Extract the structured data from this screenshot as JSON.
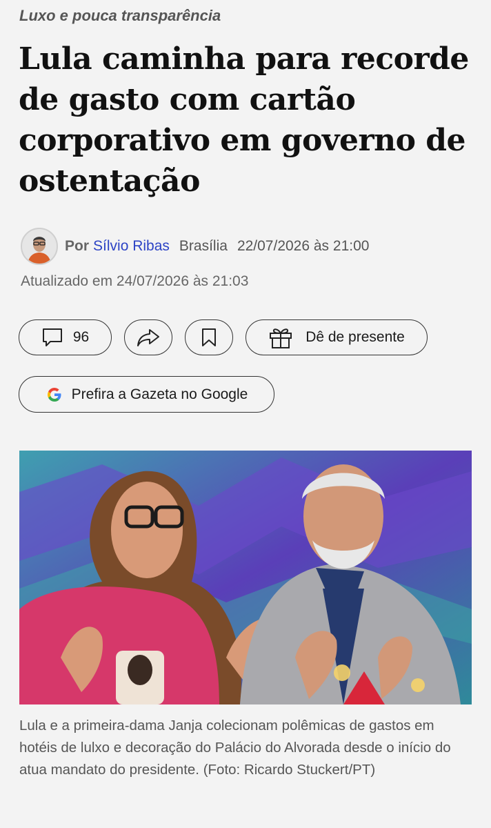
{
  "article": {
    "kicker": "Luxo e pouca transparência",
    "title": "Lula caminha para recorde de gasto com cartão corporativo em governo de ostentação",
    "byline": {
      "prefix": "Por",
      "author": "Sílvio Ribas",
      "location": "Brasília",
      "published": "22/07/2026 às 21:00"
    },
    "updated": "Atualizado em 24/07/2026 às 21:03",
    "caption": "Lula e a primeira-dama Janja colecionam polêmicas de gastos em hotéis de lulxo e decoração do Palácio do Alvorada desde o início do atua mandato do presidente. (Foto: Ricardo Stuckert/PT)"
  },
  "actions": {
    "comments_count": "96",
    "gift_label": "Dê de presente",
    "google_label": "Prefira a Gazeta no Google"
  },
  "icons": {
    "comment": "comment-icon",
    "share": "share-icon",
    "bookmark": "bookmark-icon",
    "gift": "gift-icon",
    "google": "google-icon"
  },
  "colors": {
    "author_link": "#2c43c5",
    "background": "#f3f3f3",
    "headline": "#111111"
  }
}
